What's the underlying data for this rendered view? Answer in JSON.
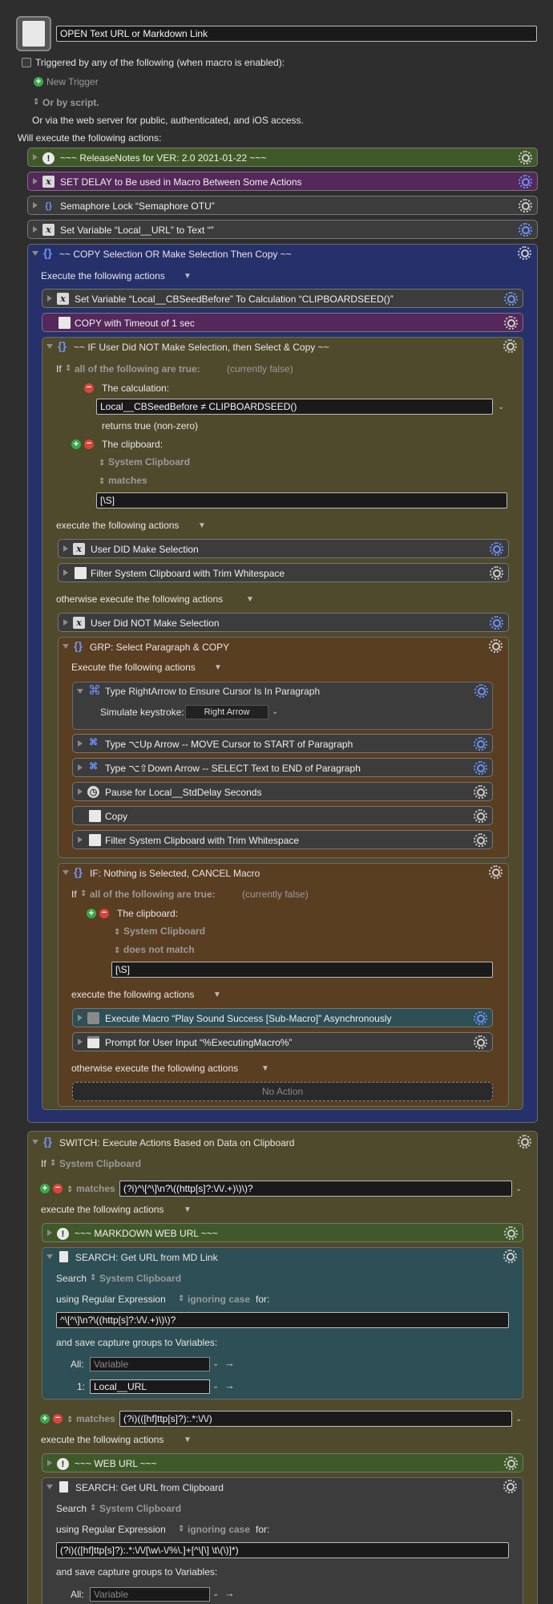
{
  "header": {
    "macro_name": "OPEN Text URL or Markdown Link",
    "triggered_by": "Triggered by any of the following (when macro is enabled):",
    "new_trigger": "New Trigger",
    "or_by_script": "Or by script.",
    "web_server": "Or via the web server for public, authenticated, and iOS access.",
    "will_execute": "Will execute the following actions:"
  },
  "actions": {
    "release_notes": "~~~ ReleaseNotes for  VER: 2.0    2021-01-22 ~~~",
    "set_delay": "SET DELAY to Be used in Macro Between Some Actions",
    "semaphore": "Semaphore Lock “Semaphore OTU”",
    "set_var_url": "Set Variable “Local__URL” to Text “”",
    "copy_group": "~~ COPY Selection OR Make Selection Then Copy ~~",
    "execute_following": "Execute the following actions",
    "set_cbseed": "Set Variable “Local__CBSeedBefore” To Calculation “CLIPBOARDSEED()”",
    "copy_timeout": "COPY with Timeout of 1 sec",
    "if_user_did_not": "~~ IF User Did NOT Make Selection, then Select & Copy ~~",
    "if_label": "If",
    "all_true": "all of the following are true:",
    "currently_false": "(currently false)",
    "the_calculation": "The calculation:",
    "calc_value": "Local__CBSeedBefore ≠ CLIPBOARDSEED()",
    "returns_true": "returns true (non-zero)",
    "the_clipboard": "The clipboard:",
    "system_clipboard": "System Clipboard",
    "matches": "matches",
    "regex_nonspace": "[\\S]",
    "execute_following_lower": "execute the following actions",
    "user_did": "User DID Make Selection",
    "filter_trim": "Filter System Clipboard with Trim Whitespace",
    "otherwise": "otherwise execute the following actions",
    "user_did_not": "User Did NOT Make Selection",
    "grp_select": "GRP:  Select Paragraph & COPY",
    "type_rightarrow": "Type RightArrow to Ensure Cursor Is In Paragraph",
    "simulate_keystroke": "Simulate keystroke:",
    "right_arrow": "Right Arrow",
    "type_up": "Type ⌥Up Arrow -- MOVE Cursor to START of Paragraph",
    "type_down": "Type ⌥⇧Down Arrow -- SELECT Text to END of Paragraph",
    "pause": "Pause for Local__StdDelay Seconds",
    "copy": "Copy",
    "if_nothing": "IF:  Nothing is Selected, CANCEL Macro",
    "does_not_match": "does not match",
    "exec_macro": "Execute Macro “Play Sound Success [Sub-Macro]” Asynchronously",
    "prompt": "Prompt for User Input “%ExecutingMacro%”",
    "no_action": "No Action",
    "switch": "SWITCH:  Execute Actions Based on Data on Clipboard",
    "regex_md": "(?i)^\\[^\\]\\n?\\((http[s]?:\\/\\/.+)\\)\\)?",
    "md_web_url": "~~~ MARKDOWN WEB URL ~~~",
    "search_md": "SEARCH:  Get URL from MD Link",
    "search": "Search",
    "using_regex": "using Regular Expression",
    "ignoring_case": "ignoring case",
    "for": "for:",
    "regex_md2": "^\\[^\\]\\n?\\((http[s]?:\\/\\/.+)\\)\\)?",
    "save_capture": "and save capture groups to Variables:",
    "all": "All:",
    "one": "1:",
    "variable_placeholder": "Variable",
    "local_url": "Local__URL",
    "regex_web": "(?i)(([hf]ttp[s]?):.*:\\/\\/)",
    "web_url": "~~~ WEB URL ~~~",
    "search_clip": "SEARCH:  Get URL from Clipboard",
    "regex_web2": "(?i)(([hf]ttp[s]?):.*:\\/\\/[\\w\\-\\/%\\.]+[^\\[\\] \\t\\(\\)]*)"
  },
  "colors": {
    "green": "#3f5a28",
    "purple": "#54285a",
    "gray": "#3c3c3c",
    "navy": "#26306a",
    "olive": "#4f4a2c",
    "brown": "#5a3e22",
    "teal": "#2d4f55"
  }
}
